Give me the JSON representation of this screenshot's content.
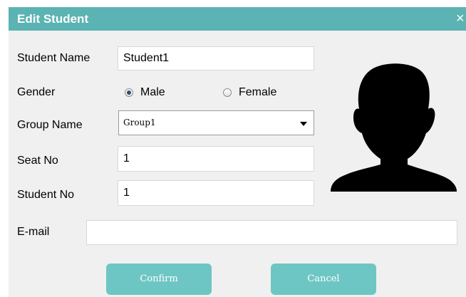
{
  "dialog": {
    "title": "Edit Student",
    "close_glyph": "×"
  },
  "form": {
    "student_name": {
      "label": "Student Name",
      "value": "Student1"
    },
    "gender": {
      "label": "Gender",
      "options": [
        {
          "label": "Male",
          "checked": true
        },
        {
          "label": "Female",
          "checked": false
        }
      ]
    },
    "group_name": {
      "label": "Group Name",
      "value": "Group1"
    },
    "seat_no": {
      "label": "Seat No",
      "value": "1"
    },
    "student_no": {
      "label": "Student No",
      "value": "1"
    },
    "email": {
      "label": "E-mail",
      "value": ""
    }
  },
  "buttons": {
    "confirm": "Confirm",
    "cancel": "Cancel"
  },
  "colors": {
    "titlebar": "#5bb3b3",
    "button": "#6ec6c4",
    "body_bg": "#f0f0f0",
    "avatar": "#000000"
  },
  "icons": {
    "avatar": "person-silhouette-icon",
    "close": "close-icon",
    "dropdown": "chevron-down-icon"
  }
}
